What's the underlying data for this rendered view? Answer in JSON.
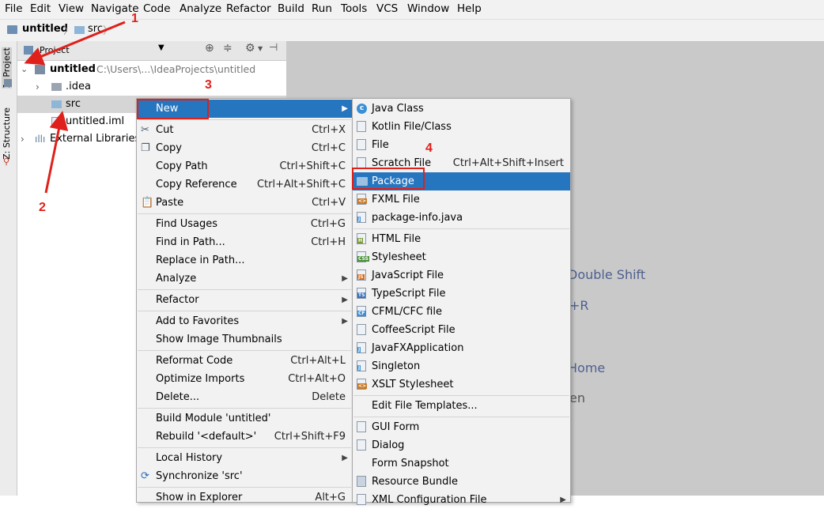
{
  "menubar": [
    "File",
    "Edit",
    "View",
    "Navigate",
    "Code",
    "Analyze",
    "Refactor",
    "Build",
    "Run",
    "Tools",
    "VCS",
    "Window",
    "Help"
  ],
  "breadcrumb": {
    "project": "untitled",
    "folder": "src"
  },
  "sidetabs": {
    "project": "1: Project",
    "structure": "Z: Structure"
  },
  "panel": {
    "dropdown": "Project"
  },
  "tree": {
    "root_name": "untitled",
    "root_path": "C:\\Users\\...\\IdeaProjects\\untitled",
    "idea": ".idea",
    "src": "src",
    "iml": "untitled.iml",
    "ext": "External Libraries"
  },
  "editor_hints": [
    "Double Shift",
    "+R",
    "Home",
    "en"
  ],
  "context_menu": [
    {
      "label": "New",
      "shortcut": "",
      "submenu": true,
      "selected": true
    },
    {
      "sep": true
    },
    {
      "label": "Cut",
      "shortcut": "Ctrl+X",
      "icon": "cut-icon"
    },
    {
      "label": "Copy",
      "shortcut": "Ctrl+C",
      "icon": "copy-icon"
    },
    {
      "label": "Copy Path",
      "shortcut": "Ctrl+Shift+C"
    },
    {
      "label": "Copy Reference",
      "shortcut": "Ctrl+Alt+Shift+C"
    },
    {
      "label": "Paste",
      "shortcut": "Ctrl+V",
      "icon": "paste-icon"
    },
    {
      "sep": true
    },
    {
      "label": "Find Usages",
      "shortcut": "Ctrl+G"
    },
    {
      "label": "Find in Path...",
      "shortcut": "Ctrl+H"
    },
    {
      "label": "Replace in Path...",
      "shortcut": ""
    },
    {
      "label": "Analyze",
      "shortcut": "",
      "submenu": true
    },
    {
      "sep": true
    },
    {
      "label": "Refactor",
      "shortcut": "",
      "submenu": true
    },
    {
      "sep": true
    },
    {
      "label": "Add to Favorites",
      "shortcut": "",
      "submenu": true
    },
    {
      "label": "Show Image Thumbnails",
      "shortcut": ""
    },
    {
      "sep": true
    },
    {
      "label": "Reformat Code",
      "shortcut": "Ctrl+Alt+L"
    },
    {
      "label": "Optimize Imports",
      "shortcut": "Ctrl+Alt+O"
    },
    {
      "label": "Delete...",
      "shortcut": "Delete"
    },
    {
      "sep": true
    },
    {
      "label": "Build Module 'untitled'",
      "shortcut": ""
    },
    {
      "label": "Rebuild '<default>'",
      "shortcut": "Ctrl+Shift+F9"
    },
    {
      "sep": true
    },
    {
      "label": "Local History",
      "shortcut": "",
      "submenu": true
    },
    {
      "label": "Synchronize 'src'",
      "shortcut": "",
      "icon": "sync-icon"
    },
    {
      "sep": true
    },
    {
      "label": "Show in Explorer",
      "shortcut": "Alt+G"
    }
  ],
  "new_menu": [
    {
      "label": "Java Class",
      "icon": "class",
      "badge": "C"
    },
    {
      "label": "Kotlin File/Class",
      "icon": "kotlin"
    },
    {
      "label": "File",
      "icon": "file"
    },
    {
      "label": "Scratch File",
      "shortcut": "Ctrl+Alt+Shift+Insert",
      "icon": "scratch"
    },
    {
      "label": "Package",
      "icon": "folder",
      "selected": true
    },
    {
      "label": "FXML File",
      "icon": "file",
      "badge": "<>"
    },
    {
      "label": "package-info.java",
      "icon": "file",
      "badge": "J"
    },
    {
      "sep": true
    },
    {
      "label": "HTML File",
      "icon": "file",
      "badge": "H"
    },
    {
      "label": "Stylesheet",
      "icon": "file",
      "badge": "CSS"
    },
    {
      "label": "JavaScript File",
      "icon": "file",
      "badge": "JS"
    },
    {
      "label": "TypeScript File",
      "icon": "file",
      "badge": "TS"
    },
    {
      "label": "CFML/CFC file",
      "icon": "file",
      "badge": "CF"
    },
    {
      "label": "CoffeeScript File",
      "icon": "file"
    },
    {
      "label": "JavaFXApplication",
      "icon": "file",
      "badge": "J"
    },
    {
      "label": "Singleton",
      "icon": "file",
      "badge": "J"
    },
    {
      "label": "XSLT Stylesheet",
      "icon": "file",
      "badge": "<>"
    },
    {
      "sep": true
    },
    {
      "label": "Edit File Templates...",
      "icon": ""
    },
    {
      "sep": true
    },
    {
      "label": "GUI Form",
      "icon": "file"
    },
    {
      "label": "Dialog",
      "icon": "file"
    },
    {
      "label": "Form Snapshot",
      "icon": ""
    },
    {
      "label": "Resource Bundle",
      "icon": "bundle"
    },
    {
      "label": "XML Configuration File",
      "icon": "file",
      "submenu": true
    }
  ],
  "annotations": [
    "1",
    "2",
    "3",
    "4"
  ],
  "colors": {
    "selection": "#2675bf",
    "annotation": "#e0201a",
    "folder": "#8fb6d9"
  }
}
